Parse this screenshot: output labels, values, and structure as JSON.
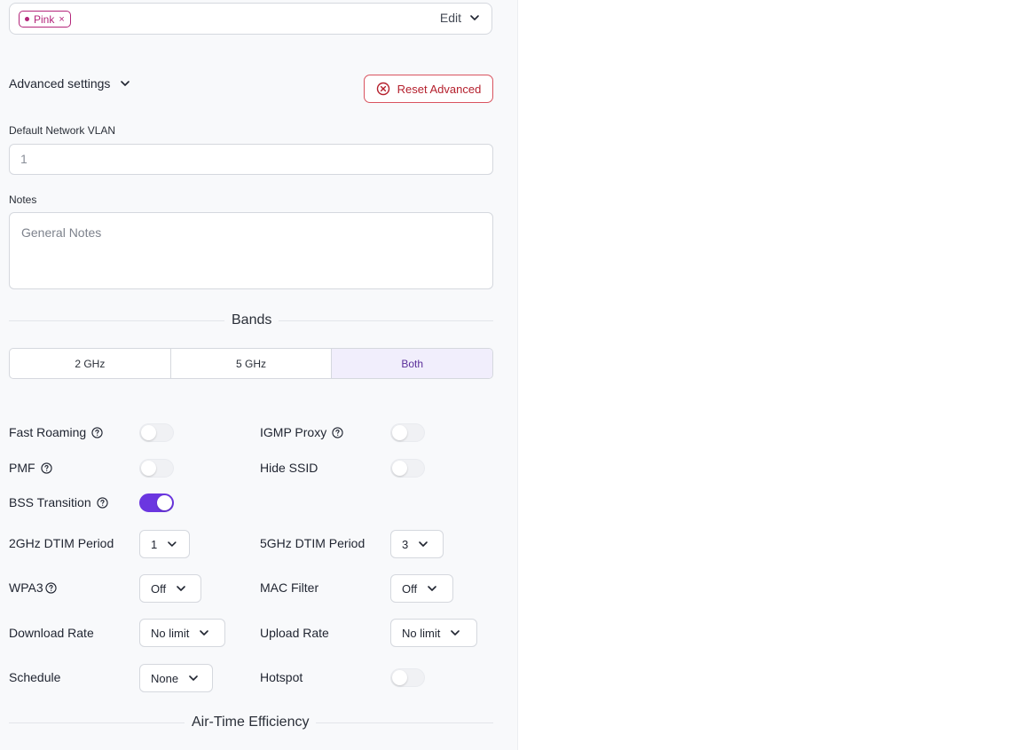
{
  "tags": {
    "chip_label": "Pink",
    "chip_remove": "×",
    "edit_label": "Edit"
  },
  "advanced": {
    "toggle_label": "Advanced settings",
    "reset_label": "Reset Advanced"
  },
  "vlan": {
    "label": "Default Network VLAN",
    "value": "1"
  },
  "notes": {
    "label": "Notes",
    "placeholder": "General Notes"
  },
  "bands": {
    "title": "Bands",
    "options": [
      "2 GHz",
      "5 GHz",
      "Both"
    ],
    "selected": "Both"
  },
  "settings": {
    "fast_roaming": {
      "label": "Fast Roaming",
      "on": false
    },
    "igmp_proxy": {
      "label": "IGMP Proxy",
      "on": false
    },
    "pmf": {
      "label": "PMF",
      "on": false
    },
    "hide_ssid": {
      "label": "Hide SSID",
      "on": false
    },
    "bss_transition": {
      "label": "BSS Transition",
      "on": true
    },
    "dtim_2ghz": {
      "label": "2GHz DTIM Period",
      "value": "1"
    },
    "dtim_5ghz": {
      "label": "5GHz DTIM Period",
      "value": "3"
    },
    "wpa3": {
      "label": "WPA3",
      "value": "Off"
    },
    "mac_filter": {
      "label": "MAC Filter",
      "value": "Off"
    },
    "download_rate": {
      "label": "Download Rate",
      "value": "No limit"
    },
    "upload_rate": {
      "label": "Upload Rate",
      "value": "No limit"
    },
    "schedule": {
      "label": "Schedule",
      "value": "None"
    },
    "hotspot": {
      "label": "Hotspot",
      "on": false
    }
  },
  "airtime": {
    "title": "Air-Time Efficiency"
  },
  "colors": {
    "accent": "#6b36e0",
    "tag": "#b3257a",
    "danger": "#b41f2c",
    "selected_bg": "#f1eefc"
  }
}
